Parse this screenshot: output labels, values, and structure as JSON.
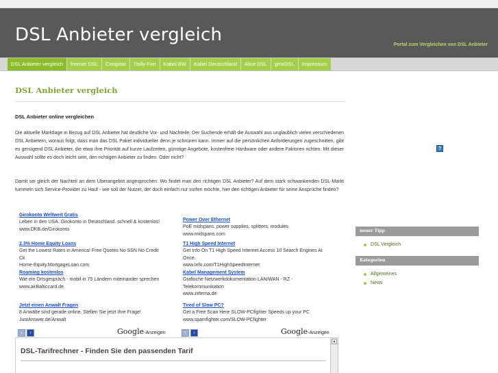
{
  "header": {
    "site_title": "DSL Anbieter vergleich",
    "tagline": "Portal zum Vergleichen von DSL Anbieter"
  },
  "nav": {
    "items": [
      {
        "label": "DSL Anbieter vergleich",
        "active": true
      },
      {
        "label": "freenet DSL"
      },
      {
        "label": "Congstar"
      },
      {
        "label": "Dolly-Fon"
      },
      {
        "label": "Kabel BW"
      },
      {
        "label": "Kabel Deutschland"
      },
      {
        "label": "Alice DSL"
      },
      {
        "label": "gmxDSL"
      },
      {
        "label": "Impressum"
      }
    ]
  },
  "post": {
    "title": "DSL Anbieter vergleich",
    "subtitle": "DSL Anbieter online vergleichen",
    "paragraph1": "Die aktuelle Marktlage in Bezug auf DSL Anbieter hat deutliche Vor- und Nachteile: Der Suchende erhält die Auswahl aus unglaublich vielen verschiedenen DSL Anbietern, woraus folgt, dass man das DSL Paket individueller denn je schnüren kann. Immer auf die persönlichen Anforderungen zugeschnitten, gibt es genügend DSL Anbieter, die etwa ihre Priorität auf kurze Laufzeiten, günstige Angebote, kostenfreie Hardware oder andere Faktoren richten. Mit dieser Auswahl sollte es doch leicht sein, den richtigen Anbieter zu finden. Oder nicht?",
    "paragraph2": "Damit sei gleich der Nachteil an dem Überangebot angesprochen: Wo findet man den richtigen DSL Anbieter? Auf dem stark schwankenden DSL-Markt tummeln sich Service-Provider zu Hauf - wie soll der Nutzer, der doch einfach nur surfen möchte, hier den richtigen Anbieter für seine Ansprüche finden?"
  },
  "help_icon": "?",
  "ads": {
    "left": [
      {
        "title": "Girokonto Weltweit Gratis",
        "text": "Leben in den USA. Girokonto in Deutschland. schnell & kostenlos!",
        "url": "www.DKB.de/Girokonto"
      },
      {
        "title": "2.3% Home Equity Loans",
        "text": "Get the Lowest Rates in America! Free Quotes No SSN No Credit Ck",
        "url": "Home-Equity.MortgageLoan.com"
      },
      {
        "title": "Roaming kostenlos",
        "text": "Wie ein Ortsgespräch - mobil in 75 Ländern miteinander sprechen",
        "url": "www.airBalticcard.de"
      },
      {
        "title": "Jetzt einen Anwalt Fragen",
        "text": "8 Anwälte sind gerade online. Stellen Sie jetzt Ihre Frage!",
        "url": "JustAnswer.de/Anwalt"
      }
    ],
    "right": [
      {
        "title": "Power Over Ethernet",
        "text": "PoE midspans, power supplies, splitters, modules",
        "url": "www.midspans.com"
      },
      {
        "title": "T1 High Speed Internet",
        "text": "Get Info On T1 High Speed Internet Access 10 Search Engines At Once.",
        "url": "www.Info.com/T1HighSpeedInternet"
      },
      {
        "title": "Kabel Management System",
        "text": "Grafische Netzwerkdokumentation LAN/WAN - RZ - Telekommunikation",
        "url": "www.zetema.de"
      },
      {
        "title": "Tired of Slow PC?",
        "text": "Get a Free Scan Here SLOW-PCfighter Speeds up your PC",
        "url": "www.spamfighter.com/SLOW-PCfighter"
      }
    ],
    "prev_glyph": "‹",
    "next_glyph": "›",
    "google_word": "Google",
    "anzeigen_label": "-Anzeigen"
  },
  "calculator": {
    "title": "DSL-Tarifrechner - Finden Sie den passenden Tarif",
    "scroll_up_glyph": "▲"
  },
  "sidebar": {
    "widget1_title": "neuer Tipp",
    "widget1_items": [
      "DSL Vergleich"
    ],
    "widget2_title": "Kategorien",
    "widget2_items": [
      "Allgemeines",
      "News"
    ]
  }
}
